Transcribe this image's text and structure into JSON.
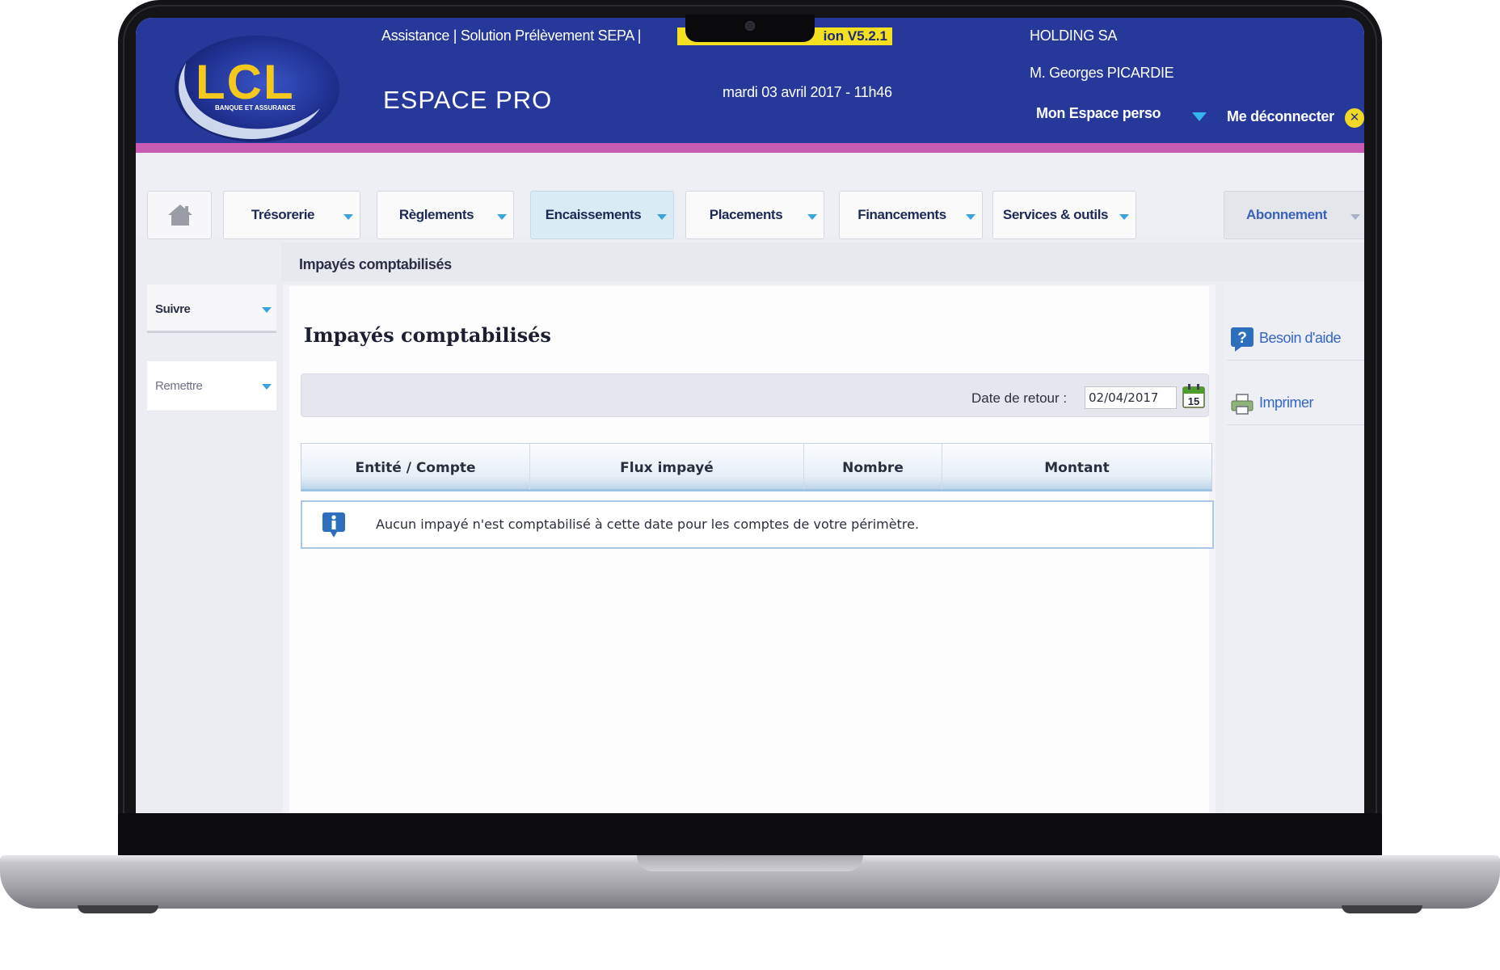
{
  "header": {
    "assistance_links": "Assistance | Solution Prélèvement SEPA |",
    "version_badge": "ion V5.2.1",
    "espace_title": "ESPACE PRO",
    "datetime": "mardi 03 avril 2017 - 11h46",
    "company": "HOLDING SA",
    "user_name": "M. Georges PICARDIE",
    "espace_perso": "Mon Espace perso",
    "logout": "Me déconnecter",
    "logout_icon_glyph": "✕",
    "brand_colors": {
      "header": "#26399a",
      "stripe": "#c85cb4",
      "badge": "#f4e01f"
    }
  },
  "logo": {
    "text": "LCL",
    "tagline": "BANQUE ET ASSURANCE"
  },
  "nav": {
    "home_icon": "home-icon",
    "items": [
      {
        "label": "Trésorerie",
        "active": false
      },
      {
        "label": "Règlements",
        "active": false
      },
      {
        "label": "Encaissements",
        "active": true
      },
      {
        "label": "Placements",
        "active": false
      },
      {
        "label": "Financements",
        "active": false
      },
      {
        "label": "Services & outils",
        "active": false
      }
    ],
    "abonnement": "Abonnement"
  },
  "breadcrumb": "Impayés comptabilisés",
  "sidebar": {
    "items": [
      {
        "label": "Suivre"
      },
      {
        "label": "Remettre"
      }
    ]
  },
  "main": {
    "title": "Impayés comptabilisés",
    "filter": {
      "date_label": "Date de retour :",
      "date_value": "02/04/2017",
      "calendar_icon": "calendar-icon",
      "calendar_day": "15"
    },
    "table": {
      "columns": [
        "Entité / Compte",
        "Flux impayé",
        "Nombre",
        "Montant"
      ],
      "message": "Aucun impayé n'est comptabilisé à cette date pour les comptes de votre périmètre.",
      "info_icon": "info-icon"
    }
  },
  "actions": {
    "help": {
      "label": "Besoin d'aide",
      "icon": "help-icon"
    },
    "print": {
      "label": "Imprimer",
      "icon": "printer-icon"
    }
  }
}
